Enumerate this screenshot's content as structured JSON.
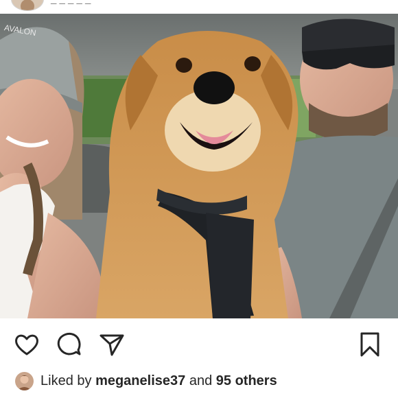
{
  "post": {
    "username": "_ _ _ _ _",
    "photo_alt": "",
    "actions": {
      "like_icon": "heart-icon",
      "comment_icon": "comment-icon",
      "share_icon": "send-icon",
      "save_icon": "bookmark-icon"
    },
    "likes": {
      "prefix": "Liked by",
      "user": "meganelise37",
      "connector": "and",
      "others": "95 others"
    }
  },
  "colors": {
    "text": "#262626",
    "icon": "#262626",
    "background": "#ffffff"
  }
}
